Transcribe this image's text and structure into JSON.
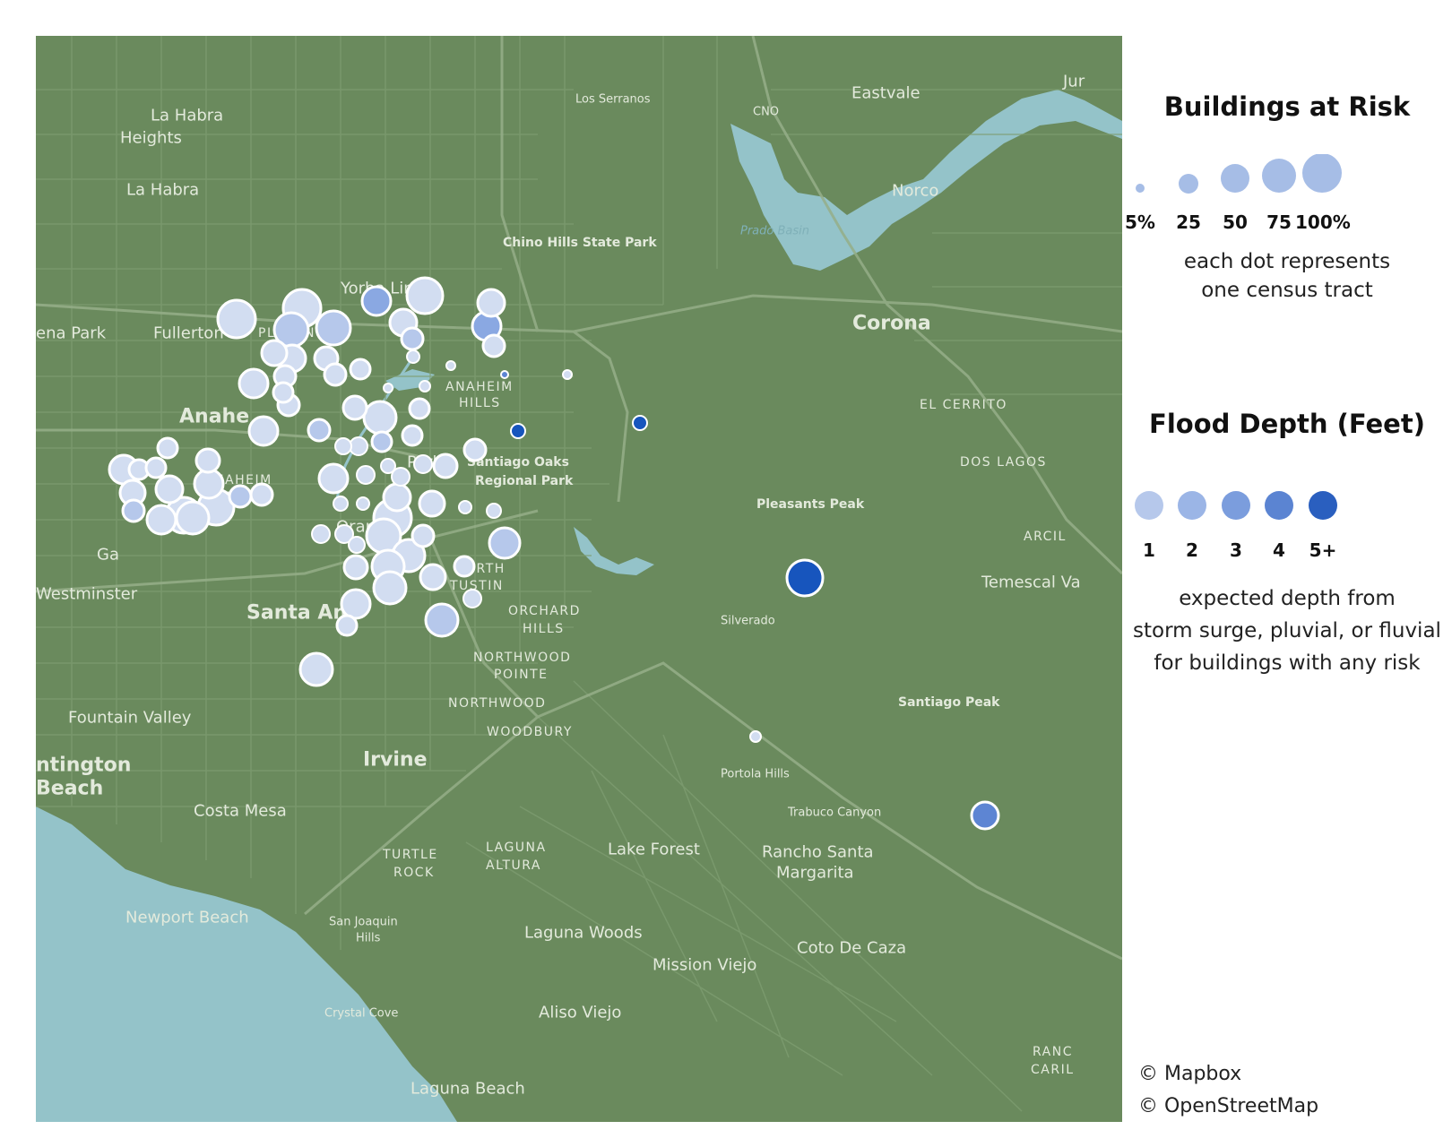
{
  "map": {
    "place_labels": [
      {
        "text": "La Habra",
        "size": "city"
      },
      {
        "text": "Heights",
        "size": "city"
      },
      {
        "text": "La Habra",
        "size": "city"
      },
      {
        "text": "Los Serranos",
        "size": "small"
      },
      {
        "text": "CNO",
        "size": "small"
      },
      {
        "text": "Eastvale",
        "size": "city"
      },
      {
        "text": "Norco",
        "size": "city"
      },
      {
        "text": "Prado Basin",
        "size": "water"
      },
      {
        "text": "Chino Hills State Park",
        "size": "park"
      },
      {
        "text": "Yorba Linda",
        "size": "city"
      },
      {
        "text": "ena Park",
        "size": "city"
      },
      {
        "text": "Fullerton",
        "size": "city"
      },
      {
        "text": "PLACENTIA",
        "size": "district"
      },
      {
        "text": "Corona",
        "size": "major"
      },
      {
        "text": "ANAHEIM",
        "size": "district"
      },
      {
        "text": "HILLS",
        "size": "district"
      },
      {
        "text": "Anahe",
        "size": "major"
      },
      {
        "text": "EL CERRITO",
        "size": "district"
      },
      {
        "text": "DOS LAGOS",
        "size": "district"
      },
      {
        "text": "Santiago Oaks",
        "size": "park"
      },
      {
        "text": "Regional Park",
        "size": "park"
      },
      {
        "text": "ANAHEIM",
        "size": "district"
      },
      {
        "text": "RESORT",
        "size": "district"
      },
      {
        "text": "Pleasants Peak",
        "size": "park"
      },
      {
        "text": "Orange",
        "size": "city"
      },
      {
        "text": "Park",
        "size": "city"
      },
      {
        "text": "Ga",
        "size": "city"
      },
      {
        "text": "ARCIL",
        "size": "district"
      },
      {
        "text": "Westminster",
        "size": "city"
      },
      {
        "text": "Temescal Va",
        "size": "city"
      },
      {
        "text": "NORTH",
        "size": "district"
      },
      {
        "text": "TUSTIN",
        "size": "district"
      },
      {
        "text": "Santa Ana",
        "size": "major"
      },
      {
        "text": "ORCHARD",
        "size": "district"
      },
      {
        "text": "HILLS",
        "size": "district"
      },
      {
        "text": "Silverado",
        "size": "small"
      },
      {
        "text": "NORTHWOOD",
        "size": "district"
      },
      {
        "text": "POINTE",
        "size": "district"
      },
      {
        "text": "NORTHWOOD",
        "size": "district"
      },
      {
        "text": "Santiago Peak",
        "size": "park"
      },
      {
        "text": "Fountain Valley",
        "size": "city"
      },
      {
        "text": "WOODBURY",
        "size": "district"
      },
      {
        "text": "Irvine",
        "size": "major"
      },
      {
        "text": "ntington",
        "size": "major"
      },
      {
        "text": "Beach",
        "size": "major"
      },
      {
        "text": "Portola Hills",
        "size": "small"
      },
      {
        "text": "Costa Mesa",
        "size": "city"
      },
      {
        "text": "Trabuco Canyon",
        "size": "small"
      },
      {
        "text": "Lake Forest",
        "size": "city"
      },
      {
        "text": "Rancho Santa",
        "size": "city"
      },
      {
        "text": "Margarita",
        "size": "city"
      },
      {
        "text": "TURTLE",
        "size": "district"
      },
      {
        "text": "ROCK",
        "size": "district"
      },
      {
        "text": "LAGUNA",
        "size": "district"
      },
      {
        "text": "ALTURA",
        "size": "district"
      },
      {
        "text": "Newport Beach",
        "size": "city"
      },
      {
        "text": "San Joaquin",
        "size": "small"
      },
      {
        "text": "Hills",
        "size": "small"
      },
      {
        "text": "Laguna Woods",
        "size": "city"
      },
      {
        "text": "Coto De Caza",
        "size": "city"
      },
      {
        "text": "Mission Viejo",
        "size": "city"
      },
      {
        "text": "Crystal Cove",
        "size": "small"
      },
      {
        "text": "Aliso Viejo",
        "size": "city"
      },
      {
        "text": "Laguna Beach",
        "size": "city"
      },
      {
        "text": "RANC",
        "size": "district"
      },
      {
        "text": "CARIL",
        "size": "district"
      },
      {
        "text": "Jur",
        "size": "city"
      }
    ],
    "tracts": [
      [
        264,
        356,
        21,
        1
      ],
      [
        337,
        344,
        21,
        1
      ],
      [
        325,
        368,
        19,
        2
      ],
      [
        372,
        366,
        19,
        2
      ],
      [
        420,
        336,
        16,
        3
      ],
      [
        474,
        330,
        20,
        1
      ],
      [
        548,
        338,
        15,
        1
      ],
      [
        543,
        364,
        16,
        3
      ],
      [
        450,
        360,
        15,
        1
      ],
      [
        460,
        378,
        12,
        2
      ],
      [
        551,
        386,
        12,
        1
      ],
      [
        306,
        394,
        14,
        1
      ],
      [
        326,
        400,
        15,
        1
      ],
      [
        364,
        400,
        13,
        1
      ],
      [
        374,
        418,
        12,
        1
      ],
      [
        402,
        412,
        11,
        1
      ],
      [
        461,
        398,
        7,
        1
      ],
      [
        503,
        408,
        5,
        1
      ],
      [
        563,
        418,
        4,
        4
      ],
      [
        633,
        418,
        5,
        1
      ],
      [
        283,
        428,
        16,
        1
      ],
      [
        318,
        420,
        12,
        1
      ],
      [
        316,
        438,
        11,
        1
      ],
      [
        322,
        452,
        12,
        1
      ],
      [
        433,
        433,
        5,
        1
      ],
      [
        474,
        431,
        6,
        1
      ],
      [
        396,
        455,
        13,
        1
      ],
      [
        424,
        466,
        18,
        1
      ],
      [
        468,
        456,
        11,
        1
      ],
      [
        294,
        481,
        16,
        1
      ],
      [
        356,
        480,
        12,
        2
      ],
      [
        383,
        498,
        9,
        1
      ],
      [
        400,
        498,
        10,
        1
      ],
      [
        426,
        493,
        11,
        2
      ],
      [
        460,
        486,
        11,
        1
      ],
      [
        530,
        502,
        12,
        1
      ],
      [
        578,
        481,
        8,
        5
      ],
      [
        714,
        472,
        8,
        5
      ],
      [
        138,
        524,
        16,
        1
      ],
      [
        155,
        524,
        11,
        1
      ],
      [
        174,
        522,
        11,
        1
      ],
      [
        187,
        500,
        11,
        1
      ],
      [
        232,
        514,
        13,
        1
      ],
      [
        148,
        550,
        14,
        1
      ],
      [
        189,
        546,
        15,
        1
      ],
      [
        149,
        570,
        12,
        2
      ],
      [
        180,
        580,
        16,
        1
      ],
      [
        205,
        575,
        20,
        1
      ],
      [
        215,
        578,
        18,
        1
      ],
      [
        241,
        566,
        20,
        1
      ],
      [
        233,
        540,
        16,
        1
      ],
      [
        268,
        554,
        12,
        2
      ],
      [
        292,
        552,
        12,
        1
      ],
      [
        372,
        534,
        16,
        1
      ],
      [
        408,
        530,
        10,
        1
      ],
      [
        433,
        520,
        8,
        1
      ],
      [
        447,
        532,
        10,
        1
      ],
      [
        472,
        518,
        10,
        1
      ],
      [
        497,
        520,
        13,
        1
      ],
      [
        443,
        555,
        15,
        1
      ],
      [
        438,
        578,
        21,
        1
      ],
      [
        380,
        562,
        8,
        1
      ],
      [
        405,
        562,
        7,
        1
      ],
      [
        482,
        562,
        14,
        1
      ],
      [
        519,
        566,
        7,
        1
      ],
      [
        551,
        570,
        8,
        1
      ],
      [
        358,
        596,
        10,
        1
      ],
      [
        384,
        596,
        10,
        1
      ],
      [
        398,
        608,
        9,
        1
      ],
      [
        428,
        598,
        19,
        1
      ],
      [
        472,
        598,
        12,
        1
      ],
      [
        456,
        620,
        18,
        1
      ],
      [
        563,
        606,
        17,
        2
      ],
      [
        397,
        633,
        13,
        1
      ],
      [
        433,
        632,
        18,
        1
      ],
      [
        483,
        644,
        14,
        1
      ],
      [
        518,
        632,
        11,
        1
      ],
      [
        435,
        656,
        18,
        1
      ],
      [
        397,
        674,
        16,
        1
      ],
      [
        527,
        668,
        10,
        1
      ],
      [
        387,
        698,
        11,
        1
      ],
      [
        493,
        692,
        18,
        2
      ],
      [
        353,
        747,
        18,
        1
      ],
      [
        898,
        645,
        20,
        5
      ],
      [
        843,
        822,
        6,
        1
      ],
      [
        1099,
        910,
        15,
        4
      ]
    ]
  },
  "legend": {
    "size_title": "Buildings at Risk",
    "size_ticks": [
      "5%",
      "25",
      "50",
      "75",
      "100%"
    ],
    "size_note_1": "each dot represents",
    "size_note_2": "one census tract",
    "depth_title": "Flood Depth (Feet)",
    "depth_ticks": [
      "1",
      "2",
      "3",
      "4",
      "5+"
    ],
    "depth_note_1": "expected depth from",
    "depth_note_2": "storm surge, pluvial, or fluvial",
    "depth_note_3": "for buildings with any risk"
  },
  "credits": {
    "mapbox": "© Mapbox",
    "osm": "© OpenStreetMap"
  },
  "colors": {
    "land": "#6a8a5d",
    "water": "#94c3c9",
    "road": "#8aa57c",
    "label": "#e3eadc",
    "depth_1": "#d2ddf1",
    "depth_2": "#b6c8eb",
    "depth_3": "#8aa8e2",
    "depth_4": "#5d85d3",
    "depth_5": "#1755bd"
  }
}
